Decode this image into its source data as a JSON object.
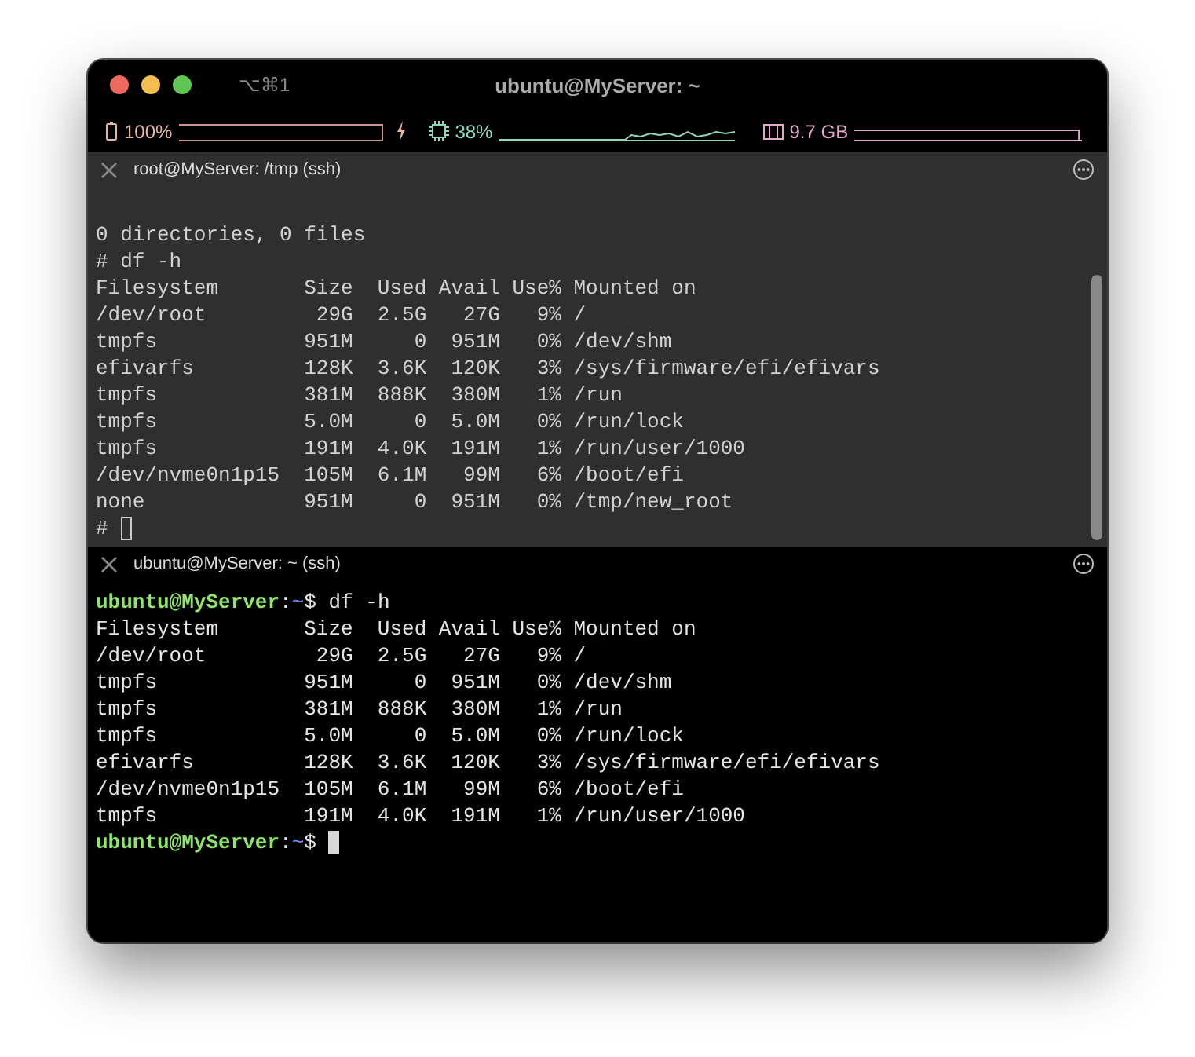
{
  "window": {
    "shortcut": "⌥⌘1",
    "title": "ubuntu@MyServer: ~"
  },
  "status_bar": {
    "battery": "100%",
    "cpu": "38%",
    "memory": "9.7 GB"
  },
  "panes": [
    {
      "title": "root@MyServer: /tmp (ssh)",
      "focused": false,
      "lines": [
        {
          "kind": "blank"
        },
        {
          "kind": "text",
          "text": "0 directories, 0 files"
        },
        {
          "kind": "text",
          "text": "# df -h"
        },
        {
          "kind": "text",
          "text": "Filesystem       Size  Used Avail Use% Mounted on"
        },
        {
          "kind": "text",
          "text": "/dev/root         29G  2.5G   27G   9% /"
        },
        {
          "kind": "text",
          "text": "tmpfs            951M     0  951M   0% /dev/shm"
        },
        {
          "kind": "text",
          "text": "efivarfs         128K  3.6K  120K   3% /sys/firmware/efi/efivars"
        },
        {
          "kind": "text",
          "text": "tmpfs            381M  888K  380M   1% /run"
        },
        {
          "kind": "text",
          "text": "tmpfs            5.0M     0  5.0M   0% /run/lock"
        },
        {
          "kind": "text",
          "text": "tmpfs            191M  4.0K  191M   1% /run/user/1000"
        },
        {
          "kind": "text",
          "text": "/dev/nvme0n1p15  105M  6.1M   99M   6% /boot/efi"
        },
        {
          "kind": "text",
          "text": "none             951M     0  951M   0% /tmp/new_root"
        },
        {
          "kind": "cursor",
          "text": "# "
        }
      ]
    },
    {
      "title": "ubuntu@MyServer: ~ (ssh)",
      "focused": true,
      "lines": [
        {
          "kind": "prompt",
          "user": "ubuntu@MyServer",
          "sep": ":",
          "path": "~",
          "symbol": "$ ",
          "command": "df -h"
        },
        {
          "kind": "text",
          "text": "Filesystem       Size  Used Avail Use% Mounted on"
        },
        {
          "kind": "text",
          "text": "/dev/root         29G  2.5G   27G   9% /"
        },
        {
          "kind": "text",
          "text": "tmpfs            951M     0  951M   0% /dev/shm"
        },
        {
          "kind": "text",
          "text": "tmpfs            381M  888K  380M   1% /run"
        },
        {
          "kind": "text",
          "text": "tmpfs            5.0M     0  5.0M   0% /run/lock"
        },
        {
          "kind": "text",
          "text": "efivarfs         128K  3.6K  120K   3% /sys/firmware/efi/efivars"
        },
        {
          "kind": "text",
          "text": "/dev/nvme0n1p15  105M  6.1M   99M   6% /boot/efi"
        },
        {
          "kind": "text",
          "text": "tmpfs            191M  4.0K  191M   1% /run/user/1000"
        },
        {
          "kind": "prompt",
          "user": "ubuntu@MyServer",
          "sep": ":",
          "path": "~",
          "symbol": "$ ",
          "cursor": true
        }
      ]
    }
  ]
}
